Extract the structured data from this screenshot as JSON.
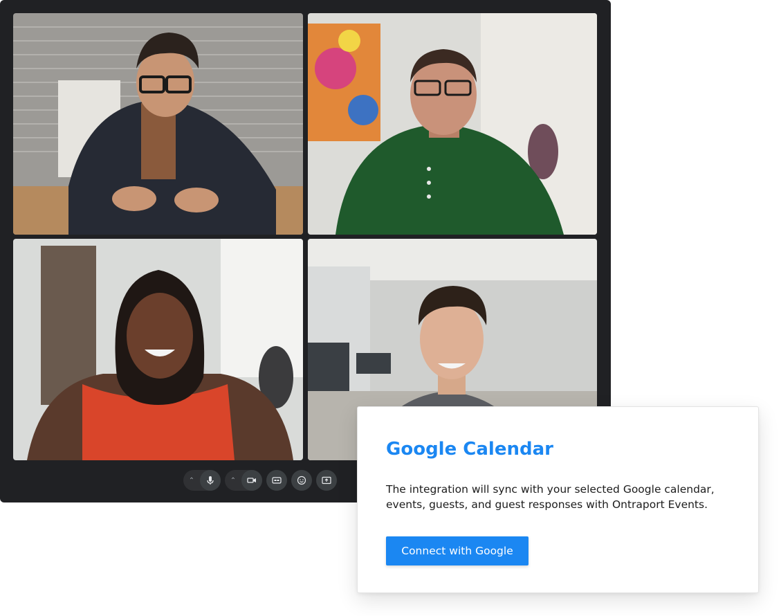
{
  "meeting": {
    "participants": [
      {
        "id": "participant-1"
      },
      {
        "id": "participant-2"
      },
      {
        "id": "participant-3"
      },
      {
        "id": "participant-4"
      }
    ],
    "controls": [
      {
        "icon": "microphone-icon"
      },
      {
        "icon": "camera-icon"
      },
      {
        "icon": "captions-icon"
      },
      {
        "icon": "emoji-icon"
      },
      {
        "icon": "present-screen-icon"
      }
    ]
  },
  "integration_card": {
    "title": "Google Calendar",
    "description": "The integration will sync with your selected Google calendar, events, guests, and guest responses with Ontraport Events.",
    "button_label": "Connect with Google"
  },
  "colors": {
    "accent": "#1b87f2",
    "meeting_background": "#202124",
    "control_background": "#3c4043"
  }
}
